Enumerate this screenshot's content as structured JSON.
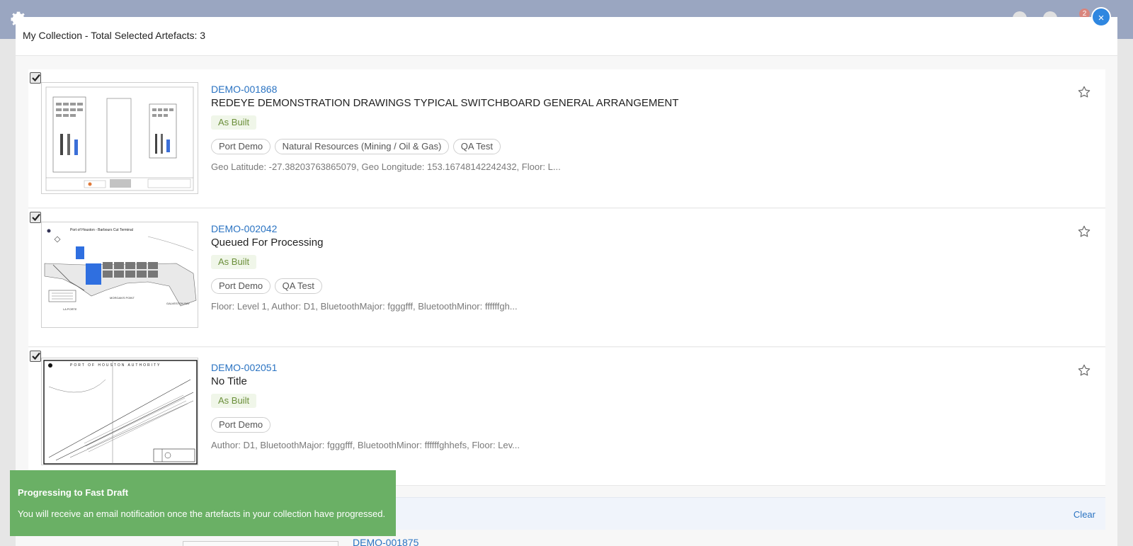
{
  "background": {
    "notification_count": "2"
  },
  "modal": {
    "title": "My Collection - Total Selected Artefacts: 3",
    "close_label": "×"
  },
  "artefacts": [
    {
      "id": "DEMO-001868",
      "title": "REDEYE DEMONSTRATION DRAWINGS TYPICAL SWITCHBOARD GENERAL ARRANGEMENT",
      "status": "As Built",
      "tags": [
        "Port Demo",
        "Natural Resources (Mining / Oil & Gas)",
        "QA Test"
      ],
      "meta": "Geo Latitude: -27.38203763865079, Geo Longitude: 153.16748142242432, Floor: L...",
      "checked": true,
      "starred": false
    },
    {
      "id": "DEMO-002042",
      "title": "Queued For Processing",
      "status": "As Built",
      "tags": [
        "Port Demo",
        "QA Test"
      ],
      "meta": "Floor: Level 1, Author: D1, BluetoothMajor: fgggfff, BluetoothMinor: ffffffgh...",
      "checked": true,
      "starred": false
    },
    {
      "id": "DEMO-002051",
      "title": "No Title",
      "status": "As Built",
      "tags": [
        "Port Demo"
      ],
      "meta": "Author: D1, BluetoothMajor: fgggfff, BluetoothMinor: ffffffghhefs, Floor: Lev...",
      "checked": true,
      "starred": false
    }
  ],
  "footer": {
    "clear_label": "Clear",
    "next_id": "DEMO-001875"
  },
  "toast": {
    "title": "Progressing to Fast Draft",
    "body": "You will receive an email notification once the artefacts in your collection have progressed."
  },
  "colors": {
    "accent": "#2a73c2",
    "toast_bg": "#6ab065",
    "status_text": "#6b8f3a",
    "close_bg": "#2f87e0"
  }
}
